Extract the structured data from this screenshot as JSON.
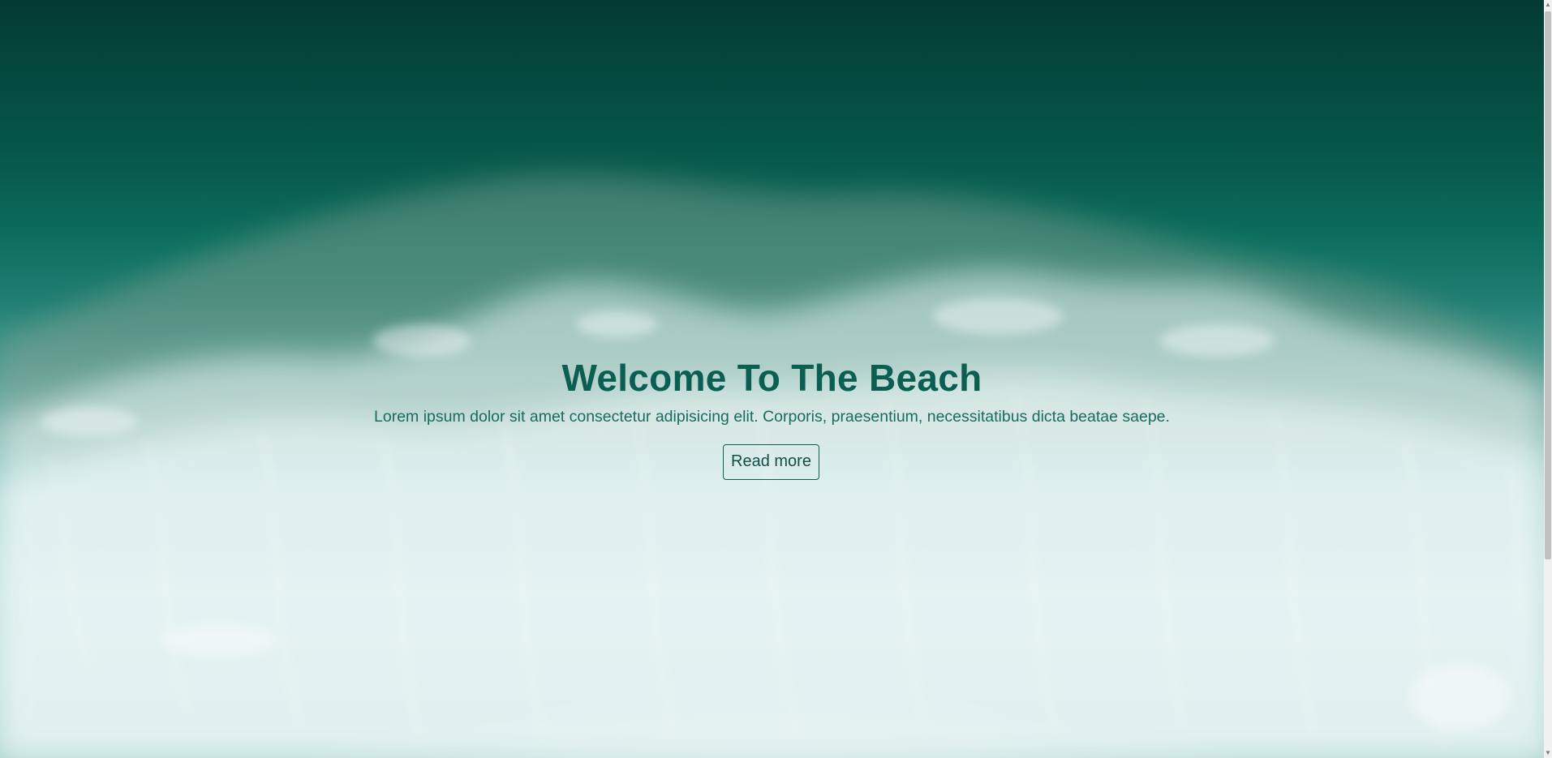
{
  "hero": {
    "title": "Welcome To The Beach",
    "subtitle": "Lorem ipsum dolor sit amet consectetur adipisicing elit. Corporis, praesentium, necessitatibus dicta beatae saepe.",
    "button_label": "Read more"
  },
  "colors": {
    "title": "#0b5e52",
    "subtitle": "#1a6b60",
    "button_border": "#0e5e53",
    "deep_sea": "#033a33",
    "foam": "#d6eeec"
  },
  "icons": {
    "scroll_up": "scroll-up-arrow-icon",
    "scroll_down": "scroll-down-arrow-icon"
  }
}
